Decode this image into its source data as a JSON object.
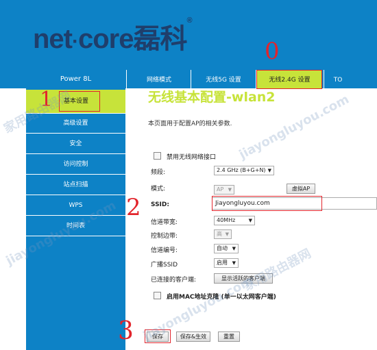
{
  "header": {
    "logo_text": "net",
    "logo_dot": "·",
    "logo_text2": "core",
    "logo_cn": "磊科",
    "logo_reg": "®"
  },
  "nav": {
    "model": "Power 8L",
    "tabs": [
      "网络模式",
      "无线5G 设置",
      "无线2.4G 设置",
      "TO"
    ]
  },
  "sidebar": {
    "items": [
      "基本设置",
      "高级设置",
      "安全",
      "访问控制",
      "站点扫描",
      "WPS",
      "时间表"
    ]
  },
  "main": {
    "title": "无线基本配置-wlan2",
    "description": "本页面用于配置AP的相关参数.",
    "disable_label": "禁用无线网络接口",
    "band_label": "频段:",
    "band_value": "2.4 GHz (B+G+N)",
    "mode_label": "模式:",
    "mode_value": "AP",
    "virtual_ap_button": "虚拟AP",
    "ssid_label": "SSID:",
    "ssid_value": "Jiayongluyou.com",
    "bandwidth_label": "信道带宽:",
    "bandwidth_value": "40MHz",
    "sideband_label": "控制边带:",
    "sideband_value": "高",
    "channel_label": "信道编号:",
    "channel_value": "自动",
    "broadcast_label": "广播SSID",
    "broadcast_value": "启用",
    "clients_label": "已连接的客户端:",
    "clients_button": "显示活跃的客户端",
    "mac_clone_label": "启用MAC地址克隆 (单一以太网客户端)"
  },
  "buttons": {
    "save": "保存",
    "save_apply": "保存&生效",
    "reset": "重置"
  },
  "annotations": {
    "step0": "0",
    "step1": "1",
    "step2": "2",
    "step3": "3"
  },
  "watermark": {
    "text_cn": "家用路由器网",
    "text_en": "jiayongluyou.com"
  },
  "colors": {
    "brand_blue": "#0d82c6",
    "accent_green": "#c7e33a",
    "annotation_red": "#e2242b",
    "logo_navy": "#1f3e6b"
  }
}
